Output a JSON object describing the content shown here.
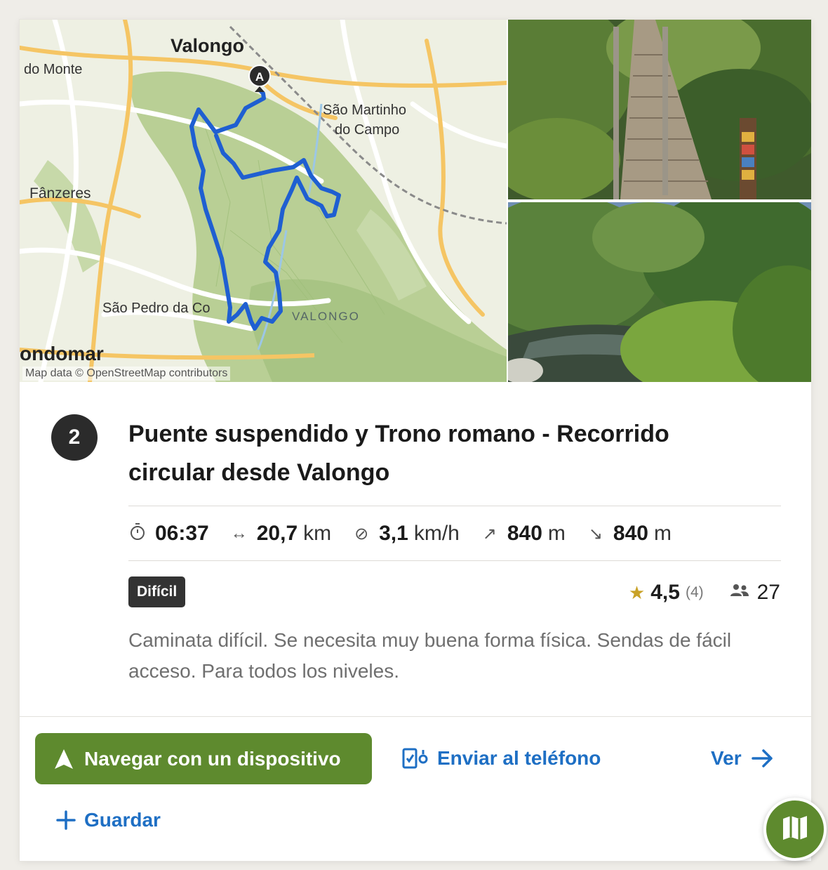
{
  "map": {
    "labels": {
      "valongo_town": "Valongo",
      "do_monte": "do Monte",
      "sao_martinho_1": "São Martinho",
      "sao_martinho_2": "do Campo",
      "fanzeres": "Fânzeres",
      "sao_pedro": "São Pedro da Co",
      "valongo_region": "VALONGO",
      "gondomar": "ondomar"
    },
    "start_marker": "A",
    "attribution": "Map data © OpenStreetMap contributors",
    "route_color": "#1f5fd1"
  },
  "route": {
    "index": "2",
    "title": "Puente suspendido y Trono romano - Recorrido circular desde Valongo",
    "stats": {
      "duration": {
        "icon": "stopwatch-icon",
        "value": "06:37"
      },
      "distance": {
        "icon": "arrows-horizontal-icon",
        "value": "20,7",
        "unit": "km"
      },
      "speed": {
        "icon": "speed-icon",
        "value": "3,1",
        "unit": "km/h"
      },
      "ascent": {
        "icon": "arrow-up-right-icon",
        "value": "840",
        "unit": "m"
      },
      "descent": {
        "icon": "arrow-down-right-icon",
        "value": "840",
        "unit": "m"
      }
    },
    "difficulty": "Difícil",
    "rating": {
      "value": "4,5",
      "count": "(4)"
    },
    "completed_count": "27",
    "description": "Caminata difícil. Se necesita muy buena forma física. Sendas de fácil acceso. Para todos los niveles."
  },
  "actions": {
    "navigate": "Navegar con un dispositivo",
    "send_to_phone": "Enviar al teléfono",
    "view": "Ver",
    "save": "Guardar"
  },
  "colors": {
    "primary_green": "#5e8a2e",
    "link_blue": "#1e6fc4",
    "star_gold": "#c9a227",
    "badge_dark": "#333333"
  }
}
